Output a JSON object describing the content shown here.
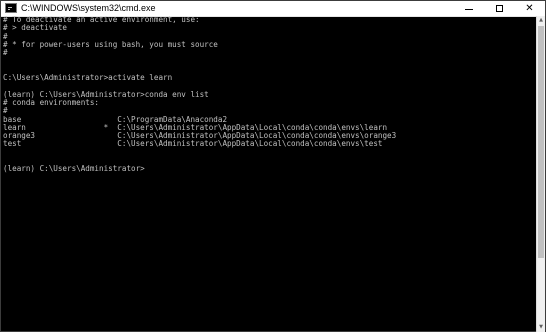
{
  "window": {
    "title": "C:\\WINDOWS\\system32\\cmd.exe",
    "icon": "cmd-icon",
    "controls": {
      "minimize": "─",
      "maximize": "☐",
      "close": "✕"
    }
  },
  "console": {
    "text_color": "#c0c0c0",
    "background": "#000000",
    "lines": [
      "# To deactivate an active environment, use:",
      "# > deactivate",
      "#",
      "# * for power-users using bash, you must source",
      "#",
      "",
      "",
      "C:\\Users\\Administrator>activate learn",
      "",
      "(learn) C:\\Users\\Administrator>conda env list",
      "# conda environments:",
      "#",
      "base                     C:\\ProgramData\\Anaconda2",
      "learn                 *  C:\\Users\\Administrator\\AppData\\Local\\conda\\conda\\envs\\learn",
      "orange3                  C:\\Users\\Administrator\\AppData\\Local\\conda\\conda\\envs\\orange3",
      "test                     C:\\Users\\Administrator\\AppData\\Local\\conda\\conda\\envs\\test",
      "",
      "",
      "(learn) C:\\Users\\Administrator>"
    ]
  }
}
